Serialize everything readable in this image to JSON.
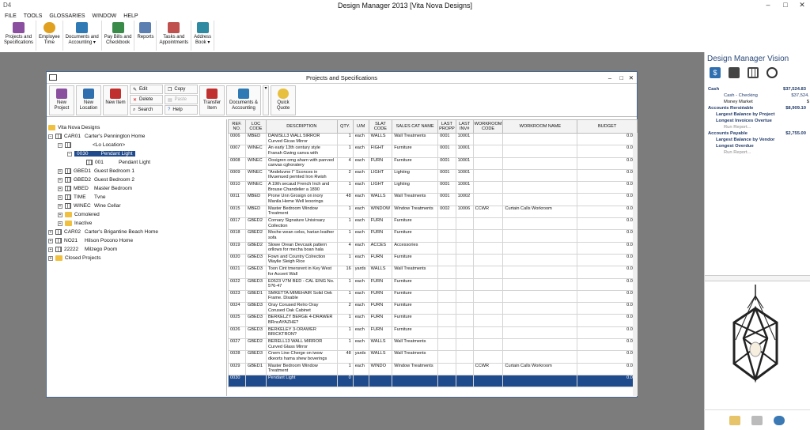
{
  "app": {
    "title": "Design Manager 2013 [Vita Nova Designs]",
    "logo": "D4"
  },
  "menu": [
    "FILE",
    "TOOLS",
    "GLOSSARIES",
    "WINDOW",
    "HELP"
  ],
  "ribbon": [
    {
      "label1": "Projects and",
      "label2": "Specifications",
      "icon": "house-icon",
      "color": "#8a4f9e"
    },
    {
      "label1": "Employee",
      "label2": "Time",
      "icon": "clock-icon",
      "color": "#e0a020"
    },
    {
      "label1": "Documents and",
      "label2": "Accounting ▾",
      "icon": "documents-icon",
      "color": "#2f7ab5"
    },
    {
      "label1": "Pay Bills and",
      "label2": "Checkbook",
      "icon": "checkbook-icon",
      "color": "#3a8a4a"
    },
    {
      "label1": "Reports",
      "label2": "",
      "icon": "reports-icon",
      "color": "#5a7fb0"
    },
    {
      "label1": "Tasks and",
      "label2": "Appointments",
      "icon": "tasks-icon",
      "color": "#c0504d"
    },
    {
      "label1": "Address",
      "label2": "Book ▾",
      "icon": "address-book-icon",
      "color": "#2e8aa0"
    }
  ],
  "window": {
    "title": "Projects and Specifications"
  },
  "toolbar": {
    "new_project": "New Project",
    "new_location": "New Location",
    "new_item": "New Item",
    "edit": "Edit",
    "delete": "Delete",
    "search": "Search",
    "copy": "Copy",
    "paste": "Paste",
    "help": "Help",
    "transfer_item": "Transfer Item",
    "documents": "Documents & Accounting",
    "quick_quote": "Quick Quote"
  },
  "tree": {
    "root": "Vita Nova Designs",
    "car01_code": "CAR01",
    "car01_name": "Carter's Pennington Home",
    "no_location": "<Lo Location>",
    "item0030_code": "0030",
    "item0030_name": "Pendant Light",
    "item001_code": "001",
    "item001_name": "Pendant Light",
    "gbed1_code": "GBED1",
    "gbed1_name": "Guest Bedroom 1",
    "gbed2_code": "GBED2",
    "gbed2_name": "Guest Bedroom 2",
    "mbed_code": "MBED",
    "mbed_name": "Master Bedroom",
    "time_code": "TIME",
    "time_name": "Tvne",
    "winec_code": "WINEC",
    "winec_name": "Wine Cellar",
    "completed": "Comolered",
    "inactive": "Inactive",
    "car02_code": "CAR02",
    "car02_name": "Carter's Brigantine Beach Home",
    "no021_code": "NO21",
    "no021_name": "Hilson Pocono Home",
    "p22222_code": "22222",
    "p22222_name": "Milzego Poom",
    "closed": "Closed Projects"
  },
  "grid": {
    "headers": [
      "REF. NO.",
      "LOC CODE",
      "DESCRIPTION",
      "QTY.",
      "U/M",
      "SLAT CODE",
      "SALES CAT NAME",
      "LAST PROPP",
      "LAST INV#",
      "WORKROOM CODE",
      "WORKROOM NAME",
      "BUDGET"
    ],
    "rows": [
      [
        "0006",
        "MBED",
        "DANISLL3 WALL 5IRROR Curved Gicas Mirror",
        "1",
        "each",
        "WALLS",
        "Wall Treatments",
        "0001",
        "10001",
        "",
        "",
        "0.00"
      ],
      [
        "0007",
        "WINEC",
        "An early 13th century style Franah Gwing canva with",
        "1",
        "each",
        "FIGHT",
        "Furniture",
        "0001",
        "10001",
        "",
        "",
        "0.00"
      ],
      [
        "0008",
        "WINEC",
        "Oosigren omg aharn with parrved canvas cghoratery",
        "4",
        "each",
        "FURN",
        "Furniture",
        "0001",
        "10001",
        "",
        "",
        "0.00"
      ],
      [
        "0009",
        "WINEC",
        "\"Andeluvne I\" Sconces in Illvuenued pemted Iron Rwish",
        "2",
        "each",
        "LIGHT",
        "Lighting",
        "0001",
        "10001",
        "",
        "",
        "0.00"
      ],
      [
        "0010",
        "WINEC",
        "A 19th secaud French Inch and Brouse Chandelier a 1890",
        "1",
        "each",
        "LIGHT",
        "Lighting",
        "0001",
        "10001",
        "",
        "",
        "0.00"
      ],
      [
        "0011",
        "MBED",
        "Prone Unn Grosign on inory Manila Heme Well leoorings",
        "48",
        "each",
        "WALLS",
        "Wall Treatments",
        "0001",
        "10002",
        "",
        "",
        "0.00"
      ],
      [
        "0015",
        "MBED",
        "Master Bedroom Window Treatment",
        "1",
        "each",
        "WINDOW",
        "Window Treatments",
        "0002",
        "10006",
        "CCWR",
        "Curtain Calls Workroom",
        "0.00"
      ],
      [
        "0017",
        "GBED2",
        "Cornary Signature Unisirsary Collection",
        "1",
        "each",
        "FURN",
        "Furniture",
        "",
        "",
        "",
        "",
        "0.00"
      ],
      [
        "0018",
        "GBED2",
        "Moche wean celss, harian leather sofa",
        "1",
        "each",
        "FURN",
        "Furniture",
        "",
        "",
        "",
        "",
        "0.00"
      ],
      [
        "0019",
        "GBED2",
        "Slowe Orean Devcask pattern orllows for mecha boan hala",
        "4",
        "each",
        "ACCES",
        "Accessories",
        "",
        "",
        "",
        "",
        "0.00"
      ],
      [
        "0020",
        "GBED3",
        "Fown and Country Colrection Waylie Sleigh Rice",
        "1",
        "each",
        "FURN",
        "Furniture",
        "",
        "",
        "",
        "",
        "0.00"
      ],
      [
        "0021",
        "GBED3",
        "Toon Cint tmersrent in Key West for Accent Wall",
        "16",
        "yards",
        "WALLS",
        "Wall Treatments",
        "",
        "",
        "",
        "",
        "0.00"
      ],
      [
        "0022",
        "GBED3",
        "E0523 V7M BED - CAL EING No. 5?6-47",
        "1",
        "each",
        "FURN",
        "Furniture",
        "",
        "",
        "",
        "",
        "0.00"
      ],
      [
        "0023",
        "GBED1",
        "SMKETTA MIMEHAIR Solid Oek Frame. Dixable",
        "1",
        "each",
        "FURN",
        "Furniture",
        "",
        "",
        "",
        "",
        "0.00"
      ],
      [
        "0024",
        "GBED3",
        "Oray Corused Relro Oray Corused Oak Cabinet",
        "2",
        "each",
        "FURN",
        "Furniture",
        "",
        "",
        "",
        "",
        "0.00"
      ],
      [
        "0025",
        "GBED3",
        "BERKELZY BERGE 4-DRAWER BRncAYAZHE?",
        "1",
        "each",
        "FURN",
        "Furniture",
        "",
        "",
        "",
        "",
        "0.00"
      ],
      [
        "0026",
        "GBED3",
        "BERKELEY 3-ORAWER BRICKTRON?",
        "1",
        "each",
        "FURN",
        "Furniture",
        "",
        "",
        "",
        "",
        "0.00"
      ],
      [
        "0027",
        "GBED2",
        "BERELL13 WALL MIRROR Curved Glass Mirror",
        "1",
        "each",
        "WALLS",
        "Wall Treatments",
        "",
        "",
        "",
        "",
        "0.00"
      ],
      [
        "0028",
        "GBED3",
        "Cnem Line Cherge on iwow dkeorts hama shew boverings",
        "48",
        "yards",
        "WALLS",
        "Wall Treatments",
        "",
        "",
        "",
        "",
        "0.00"
      ],
      [
        "0029",
        "GBED1",
        "Master Bedroom Window Treatment",
        "1",
        "each",
        "WINDO",
        "Window Treatments",
        "",
        "",
        "CCWR",
        "Curtain Calls Workroom",
        "0.00"
      ],
      [
        "0030",
        "",
        "Pendant Light",
        "0",
        "",
        "",
        "",
        "",
        "",
        "",
        "",
        "0.00"
      ]
    ]
  },
  "panel": {
    "title": "Design Manager Vision",
    "cash": "Cash",
    "cash_amt": "$37,524.83",
    "cash_checking": "Cash - Checking",
    "cash_checking_amt": "$37,524.",
    "money_market": "Money Market",
    "money_market_amt": "$",
    "ar": "Accounts Rersiéable",
    "ar_amt": "$8,909.10",
    "ar_largest": "Largest Balance by Project",
    "ar_overdue": "Longest Invoices Overtue",
    "run_report": "Run Report...",
    "ap": "Accounts Payable",
    "ap_amt": "$2,755.00",
    "ap_largest": "Largest Balance by Vendor",
    "ap_overdue": "Longest Overdue",
    "run_report2": "Run Report..."
  }
}
